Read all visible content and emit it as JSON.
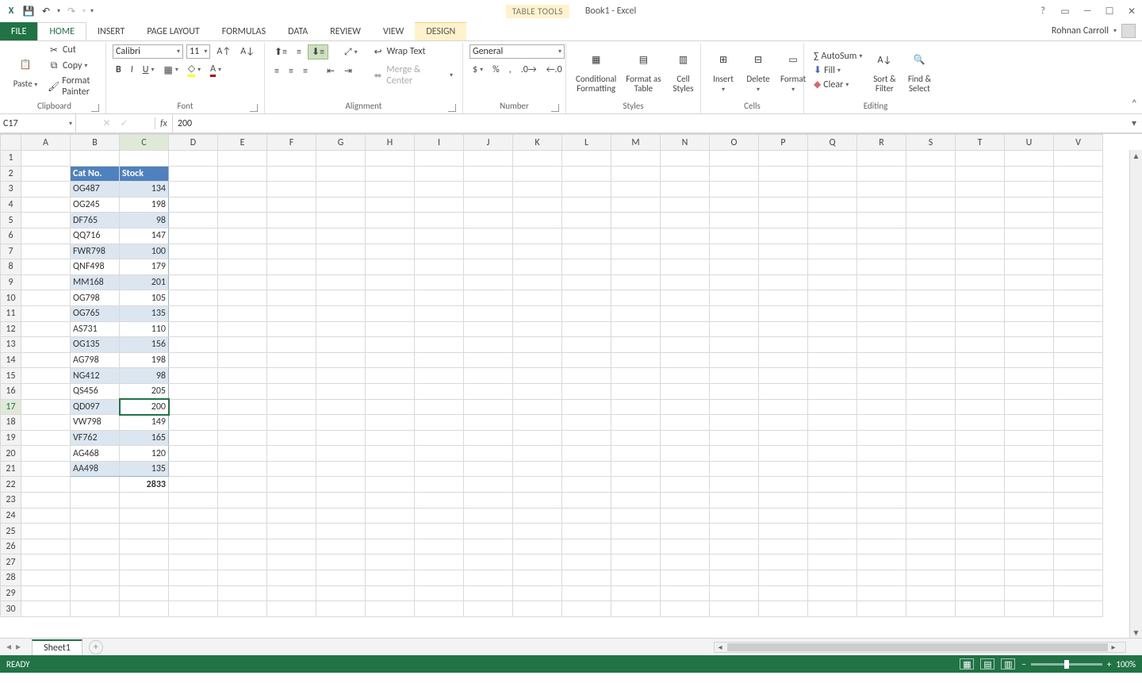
{
  "app": {
    "doc_title": "Book1 - Excel",
    "contextual_tab_group": "TABLE TOOLS",
    "user_name": "Rohnan Carroll"
  },
  "tabs": {
    "file": "FILE",
    "home": "HOME",
    "insert": "INSERT",
    "page_layout": "PAGE LAYOUT",
    "formulas": "FORMULAS",
    "data": "DATA",
    "review": "REVIEW",
    "view": "VIEW",
    "design": "DESIGN"
  },
  "ribbon": {
    "clipboard": {
      "paste": "Paste",
      "cut": "Cut",
      "copy": "Copy",
      "format_painter": "Format Painter",
      "label": "Clipboard"
    },
    "font": {
      "name": "Calibri",
      "size": "11",
      "label": "Font"
    },
    "alignment": {
      "wrap": "Wrap Text",
      "merge": "Merge & Center",
      "label": "Alignment"
    },
    "number": {
      "format": "General",
      "label": "Number"
    },
    "styles": {
      "cond": "Conditional\nFormatting",
      "table": "Format as\nTable",
      "cell": "Cell\nStyles",
      "label": "Styles"
    },
    "cells": {
      "insert": "Insert",
      "delete": "Delete",
      "format": "Format",
      "label": "Cells"
    },
    "editing": {
      "autosum": "AutoSum",
      "fill": "Fill",
      "clear": "Clear",
      "sort": "Sort &\nFilter",
      "find": "Find &\nSelect",
      "label": "Editing"
    }
  },
  "formula_bar": {
    "name_box": "C17",
    "fx": "fx",
    "value": "200"
  },
  "columns": [
    "A",
    "B",
    "C",
    "D",
    "E",
    "F",
    "G",
    "H",
    "I",
    "J",
    "K",
    "L",
    "M",
    "N",
    "O",
    "P",
    "Q",
    "R",
    "S",
    "T",
    "U",
    "V"
  ],
  "table": {
    "headers": {
      "b": "Cat No.",
      "c": "Stock"
    },
    "rows": [
      {
        "b": "OG487",
        "c": 134
      },
      {
        "b": "OG245",
        "c": 198
      },
      {
        "b": "DF765",
        "c": 98
      },
      {
        "b": "QQ716",
        "c": 147
      },
      {
        "b": "FWR798",
        "c": 100
      },
      {
        "b": "QNF498",
        "c": 179
      },
      {
        "b": "MM168",
        "c": 201
      },
      {
        "b": "OG798",
        "c": 105
      },
      {
        "b": "OG765",
        "c": 135
      },
      {
        "b": "AS731",
        "c": 110
      },
      {
        "b": "OG135",
        "c": 156
      },
      {
        "b": "AG798",
        "c": 198
      },
      {
        "b": "NG412",
        "c": 98
      },
      {
        "b": "QS456",
        "c": 205
      },
      {
        "b": "QD097",
        "c": 200
      },
      {
        "b": "VW798",
        "c": 149
      },
      {
        "b": "VF762",
        "c": 165
      },
      {
        "b": "AG468",
        "c": 120
      },
      {
        "b": "AA498",
        "c": 135
      }
    ],
    "total": 2833
  },
  "active_cell": {
    "row": 17,
    "col": "C"
  },
  "sheet": {
    "name": "Sheet1"
  },
  "status": {
    "ready": "READY",
    "zoom": "100%"
  }
}
